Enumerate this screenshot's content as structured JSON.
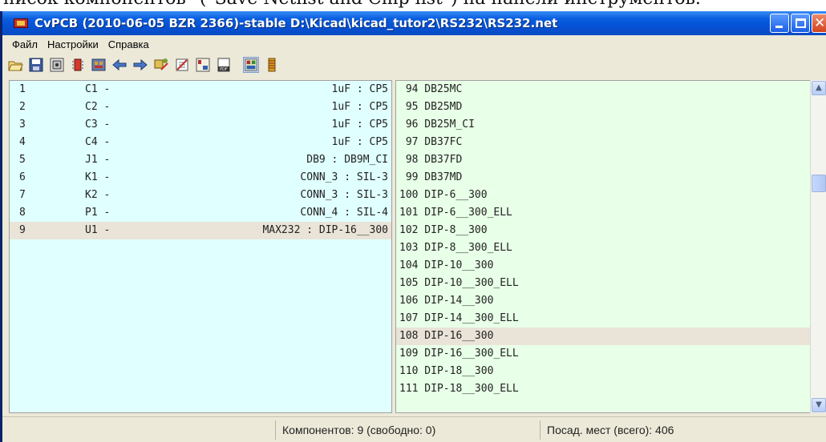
{
  "caption": "писок компонентов\" (\"Save Netlist and Cmp list\") на панели инструментов.",
  "window": {
    "title": "CvPCB (2010-06-05 BZR 2366)-stable D:\\Kicad\\kicad_tutor2\\RS232\\RS232.net"
  },
  "menu": {
    "items": [
      "Файл",
      "Настройки",
      "Справка"
    ]
  },
  "toolbar": {
    "tools": [
      "open-icon",
      "save-icon",
      "view-icon",
      "component-icon",
      "footprint-library-icon",
      "arrow-left-icon",
      "arrow-right-icon",
      "auto-associate-icon",
      "delete-association-icon",
      "display-footprint-icon",
      "pdf-icon",
      "filter-icon",
      "list-icon"
    ]
  },
  "components": [
    {
      "num": "1",
      "ref": "C1 -",
      "value": "1uF : CP5"
    },
    {
      "num": "2",
      "ref": "C2 -",
      "value": "1uF : CP5"
    },
    {
      "num": "3",
      "ref": "C3 -",
      "value": "1uF : CP5"
    },
    {
      "num": "4",
      "ref": "C4 -",
      "value": "1uF : CP5"
    },
    {
      "num": "5",
      "ref": "J1 -",
      "value": "DB9 : DB9M_CI"
    },
    {
      "num": "6",
      "ref": "K1 -",
      "value": "CONN_3 : SIL-3"
    },
    {
      "num": "7",
      "ref": "K2 -",
      "value": "CONN_3 : SIL-3"
    },
    {
      "num": "8",
      "ref": "P1 -",
      "value": "CONN_4 : SIL-4"
    },
    {
      "num": "9",
      "ref": "U1 -",
      "value": "MAX232 : DIP-16__300"
    }
  ],
  "selected_component": 9,
  "footprints": [
    {
      "num": " 94",
      "name": "DB25MC"
    },
    {
      "num": " 95",
      "name": "DB25MD"
    },
    {
      "num": " 96",
      "name": "DB25M_CI"
    },
    {
      "num": " 97",
      "name": "DB37FC"
    },
    {
      "num": " 98",
      "name": "DB37FD"
    },
    {
      "num": " 99",
      "name": "DB37MD"
    },
    {
      "num": "100",
      "name": "DIP-6__300"
    },
    {
      "num": "101",
      "name": "DIP-6__300_ELL"
    },
    {
      "num": "102",
      "name": "DIP-8__300"
    },
    {
      "num": "103",
      "name": "DIP-8__300_ELL"
    },
    {
      "num": "104",
      "name": "DIP-10__300"
    },
    {
      "num": "105",
      "name": "DIP-10__300_ELL"
    },
    {
      "num": "106",
      "name": "DIP-14__300"
    },
    {
      "num": "107",
      "name": "DIP-14__300_ELL"
    },
    {
      "num": "108",
      "name": "DIP-16__300"
    },
    {
      "num": "109",
      "name": "DIP-16__300_ELL"
    },
    {
      "num": "110",
      "name": "DIP-18__300"
    },
    {
      "num": "111",
      "name": "DIP-18__300_ELL"
    }
  ],
  "selected_footprint": "108",
  "status": {
    "components": "Компонентов: 9 (свободно: 0)",
    "footprints": "Посад. мест (всего): 406"
  }
}
